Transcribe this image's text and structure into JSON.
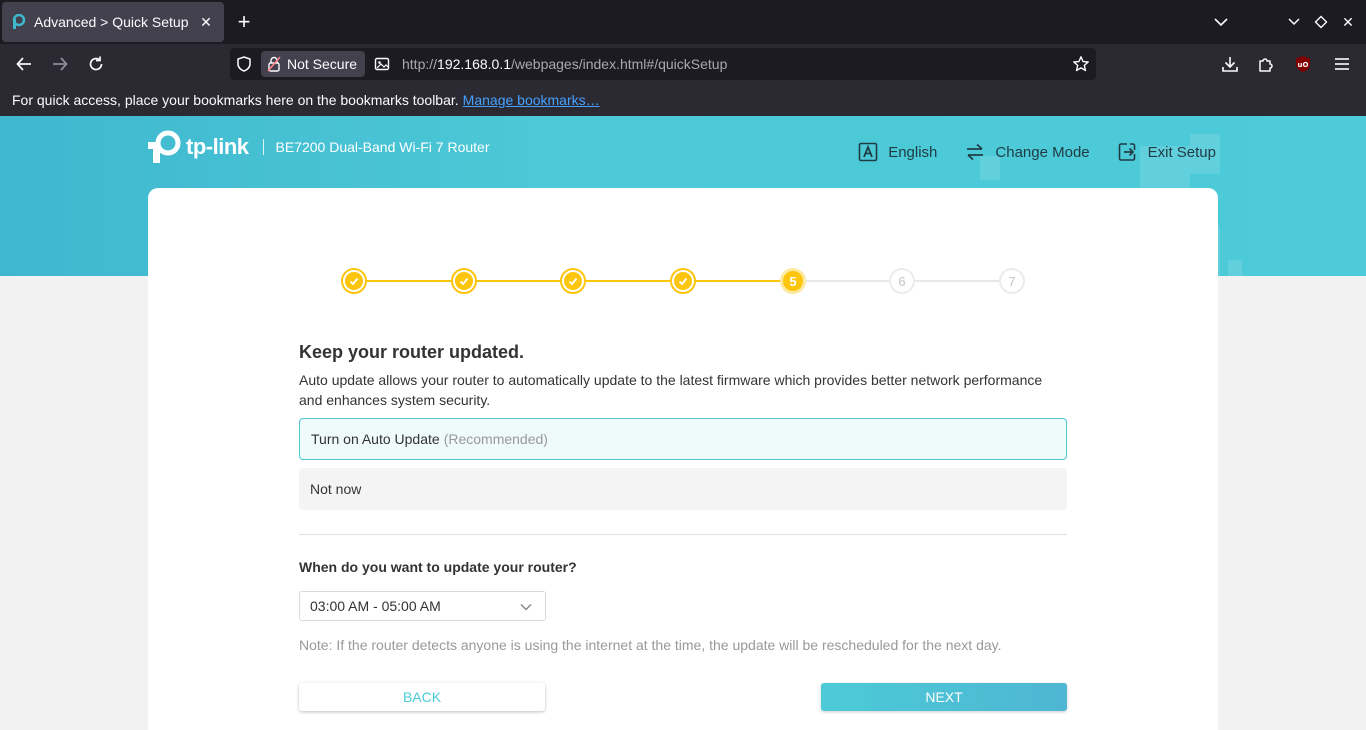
{
  "browser": {
    "tab_title": "Advanced > Quick Setup",
    "not_secure_label": "Not Secure",
    "url_prefix": "http://",
    "url_host": "192.168.0.1",
    "url_path": "/webpages/index.html#/quickSetup",
    "bookmarks_message": "For quick access, place your bookmarks here on the bookmarks toolbar.",
    "manage_bookmarks_link": "Manage bookmarks…"
  },
  "header": {
    "logo_text": "tp-link",
    "model_name": "BE7200 Dual-Band Wi-Fi 7 Router",
    "language_label": "English",
    "change_mode_label": "Change Mode",
    "exit_setup_label": "Exit Setup"
  },
  "stepper": {
    "steps": [
      {
        "label": "1",
        "state": "done"
      },
      {
        "label": "2",
        "state": "done"
      },
      {
        "label": "3",
        "state": "done"
      },
      {
        "label": "4",
        "state": "done"
      },
      {
        "label": "5",
        "state": "current"
      },
      {
        "label": "6",
        "state": "todo"
      },
      {
        "label": "7",
        "state": "todo"
      }
    ],
    "active_color": "#fdc50c"
  },
  "main": {
    "title": "Keep your router updated.",
    "description": "Auto update allows your router to automatically update to the latest firmware which provides better network performance and enhances system security.",
    "option_auto_update": "Turn on Auto Update",
    "option_auto_update_hint": "(Recommended)",
    "option_not_now": "Not now",
    "question": "When do you want to update your router?",
    "time_window_selected": "03:00 AM - 05:00 AM",
    "note": "Note: If the router detects anyone is using the internet at the time, the update will be rescheduled for the next day.",
    "back_label": "BACK",
    "next_label": "NEXT"
  },
  "colors": {
    "brand_teal": "#4acbd6",
    "step_yellow": "#fdc50c"
  }
}
